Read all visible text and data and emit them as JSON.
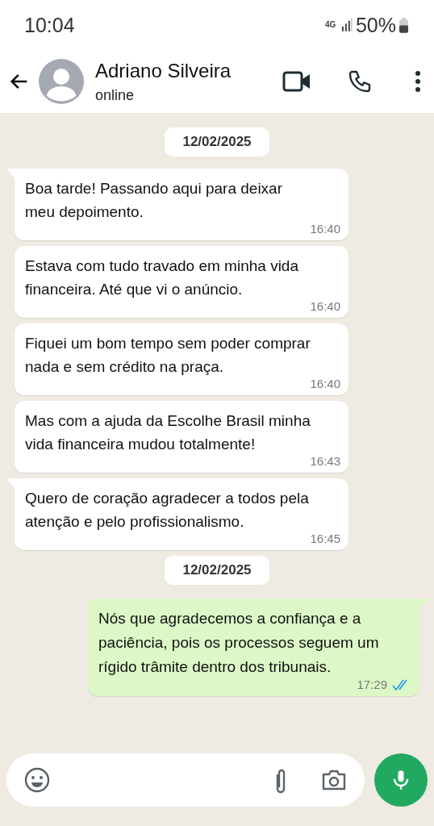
{
  "status_bar": {
    "time": "10:04",
    "network": "4G",
    "battery": "50%"
  },
  "header": {
    "contact_name": "Adriano Silveira",
    "presence": "online"
  },
  "conversation": [
    {
      "kind": "date",
      "text": "12/02/2025"
    },
    {
      "kind": "incoming",
      "text": "Boa tarde! Passando aqui para deixar meu depoimento.",
      "time": "16:40",
      "tail": true
    },
    {
      "kind": "incoming",
      "text": "Estava com tudo travado em minha vida financeira. Até que vi o anúncio.",
      "time": "16:40",
      "tail": false
    },
    {
      "kind": "incoming",
      "text": "Fiquei um bom tempo sem poder comprar nada e sem crédito na praça.",
      "time": "16:40",
      "tail": false
    },
    {
      "kind": "incoming",
      "text": "Mas com a ajuda da Escolhe Brasil minha vida financeira mudou totalmente!",
      "time": "16:43",
      "tail": false
    },
    {
      "kind": "incoming",
      "text": "Quero de coração agradecer a todos pela atenção e pelo profissionalismo.",
      "time": "16:45",
      "tail": true
    },
    {
      "kind": "date",
      "text": "12/02/2025"
    },
    {
      "kind": "outgoing",
      "text": "Nós que agradecemos a confiança e a paciência, pois os processos seguem um rígido trâmite dentro dos tribunais.",
      "time": "17:29",
      "tail": true,
      "read": true
    }
  ]
}
